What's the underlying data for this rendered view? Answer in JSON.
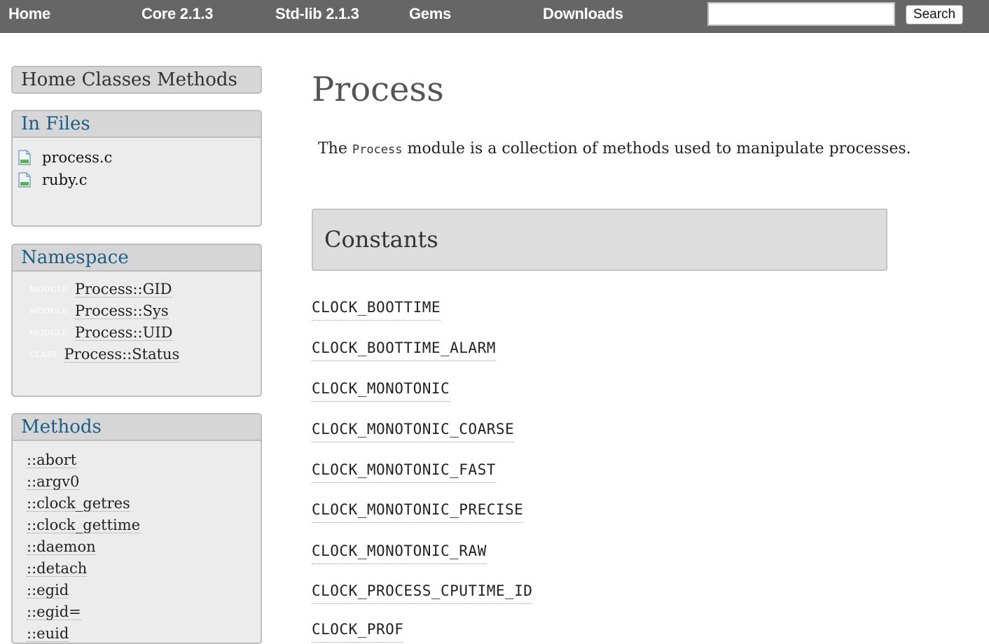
{
  "topnav": {
    "links": [
      "Home",
      "Core 2.1.3",
      "Std-lib 2.1.3",
      "Gems",
      "Downloads"
    ],
    "search_value": "",
    "search_button": "Search"
  },
  "sidebar": {
    "nav_links": [
      "Home",
      "Classes",
      "Methods"
    ],
    "in_files": {
      "title": "In Files",
      "files": [
        "process.c",
        "ruby.c"
      ]
    },
    "namespace": {
      "title": "Namespace",
      "items": [
        {
          "type": "MODULE",
          "name": "Process::GID"
        },
        {
          "type": "MODULE",
          "name": "Process::Sys"
        },
        {
          "type": "MODULE",
          "name": "Process::UID"
        },
        {
          "type": "CLASS",
          "name": "Process::Status"
        }
      ]
    },
    "methods": {
      "title": "Methods",
      "items": [
        "::abort",
        "::argv0",
        "::clock_getres",
        "::clock_gettime",
        "::daemon",
        "::detach",
        "::egid",
        "::egid=",
        "::euid"
      ]
    }
  },
  "main": {
    "title": "Process",
    "description": {
      "before": "The ",
      "code": "Process",
      "after": " module is a collection of methods used to manipulate processes."
    },
    "constants_title": "Constants",
    "constants": [
      "CLOCK_BOOTTIME",
      "CLOCK_BOOTTIME_ALARM",
      "CLOCK_MONOTONIC",
      "CLOCK_MONOTONIC_COARSE",
      "CLOCK_MONOTONIC_FAST",
      "CLOCK_MONOTONIC_PRECISE",
      "CLOCK_MONOTONIC_RAW",
      "CLOCK_PROCESS_CPUTIME_ID",
      "CLOCK_PROF"
    ]
  },
  "icons": {
    "file": "file-icon"
  },
  "colors": {
    "nav_bg": "#666666",
    "panel_header_text": "#1c5f86",
    "panel_bg": "#ececec",
    "panel_header_bg": "#d6d6d6"
  }
}
